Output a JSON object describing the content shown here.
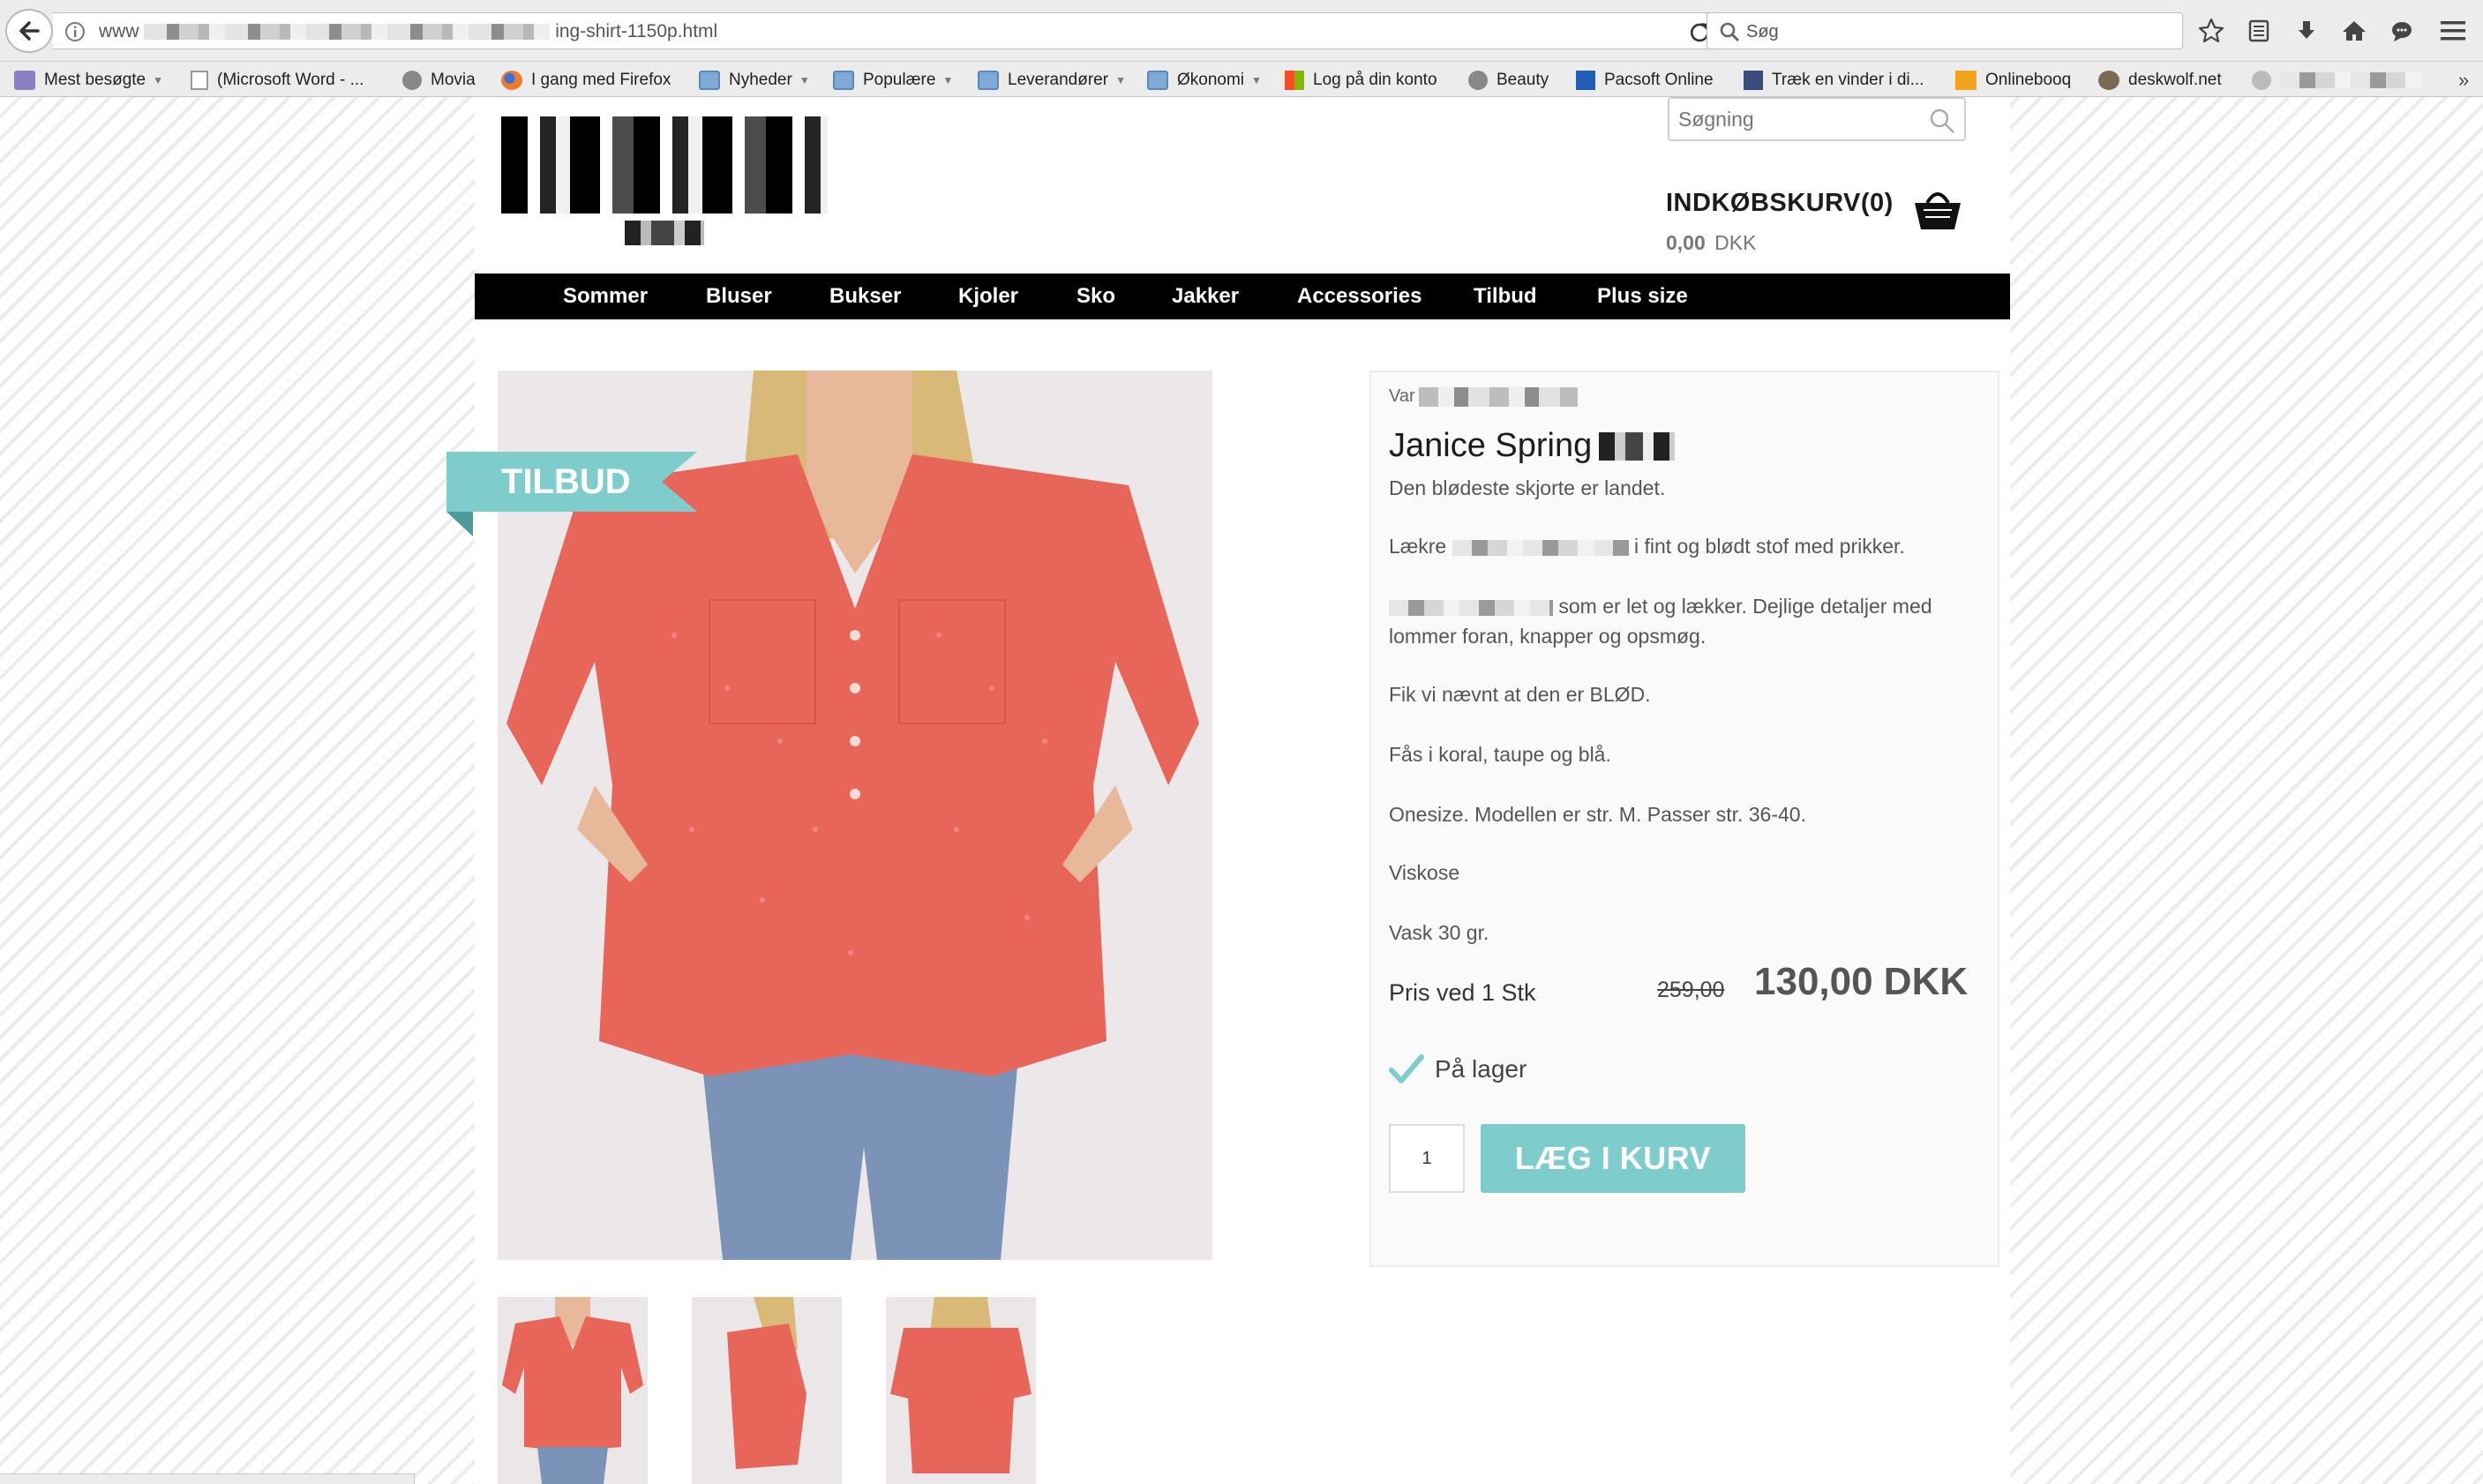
{
  "browser": {
    "url_suffix": "ing-shirt-1150p.html",
    "url_prefix": "www",
    "search_placeholder": "Søg"
  },
  "bookmarks": [
    {
      "label": "Mest besøgte",
      "has_menu": true
    },
    {
      "label": "(Microsoft Word - ...",
      "has_menu": false
    },
    {
      "label": "Movia",
      "has_menu": false
    },
    {
      "label": "I gang med Firefox",
      "has_menu": false
    },
    {
      "label": "Nyheder",
      "has_menu": true
    },
    {
      "label": "Populære",
      "has_menu": true
    },
    {
      "label": "Leverandører",
      "has_menu": true
    },
    {
      "label": "Økonomi",
      "has_menu": true
    },
    {
      "label": "Log på din konto",
      "has_menu": false
    },
    {
      "label": "Beauty",
      "has_menu": false
    },
    {
      "label": "Pacsoft Online",
      "has_menu": false
    },
    {
      "label": "Træk en vinder i di...",
      "has_menu": false
    },
    {
      "label": "Onlinebooq",
      "has_menu": false
    },
    {
      "label": "deskwolf.net",
      "has_menu": false
    }
  ],
  "site": {
    "search_placeholder": "Søgning",
    "cart_label": "INDKØBSKURV(0)",
    "cart_total": "0,00",
    "cart_currency": "DKK"
  },
  "nav": [
    "Sommer",
    "Bluser",
    "Bukser",
    "Kjoler",
    "Sko",
    "Jakker",
    "Accessories",
    "Tilbud",
    "Plus size"
  ],
  "product": {
    "badge": "TILBUD",
    "variant_label": "Var",
    "title": "Janice Spring",
    "subtitle": "Den blødeste skjorte er landet.",
    "desc1_prefix": "Lækre",
    "desc1_suffix": "i fint og blødt stof med prikker.",
    "desc2_suffix": "som er let og lækker. Dejlige detaljer med",
    "desc2_line2": "lommer foran, knapper og opsmøg.",
    "desc3": "Fik vi nævnt at den er BLØD.",
    "desc4": "Fås i koral, taupe og blå.",
    "desc5": "Onesize. Modellen er str. M. Passer str. 36-40.",
    "desc6": "Viskose",
    "desc7": "Vask 30 gr.",
    "price_label": "Pris ved 1 Stk",
    "old_price": "259,00",
    "new_price": "130,00 DKK",
    "stock": "På lager",
    "qty": "1",
    "add_label": "LÆG I KURV"
  },
  "colors": {
    "accent": "#7fcccc",
    "nav_bg": "#000000",
    "shirt": "#e8655a"
  }
}
